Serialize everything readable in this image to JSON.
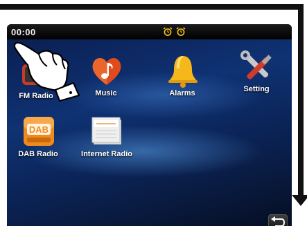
{
  "status": {
    "time": "00:00",
    "alarm_indicators": [
      "alarm-clock-icon",
      "alarm-clock-icon"
    ]
  },
  "apps": [
    {
      "label": "FM Radio",
      "icon": "radio-icon"
    },
    {
      "label": "Music",
      "icon": "music-heart-icon"
    },
    {
      "label": "Alarms",
      "icon": "bell-icon"
    },
    {
      "label": "Setting",
      "icon": "tools-icon"
    },
    {
      "label": "DAB Radio",
      "icon": "dab-icon"
    },
    {
      "label": "Internet Radio",
      "icon": "internet-radio-icon"
    }
  ],
  "dab_icon_text": "DAB",
  "back": {
    "icon": "back-arrow-icon"
  },
  "colors": {
    "screen_bg": "#0f3273",
    "alarm_yellow": "#f5c21a",
    "label_white": "#ffffff"
  }
}
